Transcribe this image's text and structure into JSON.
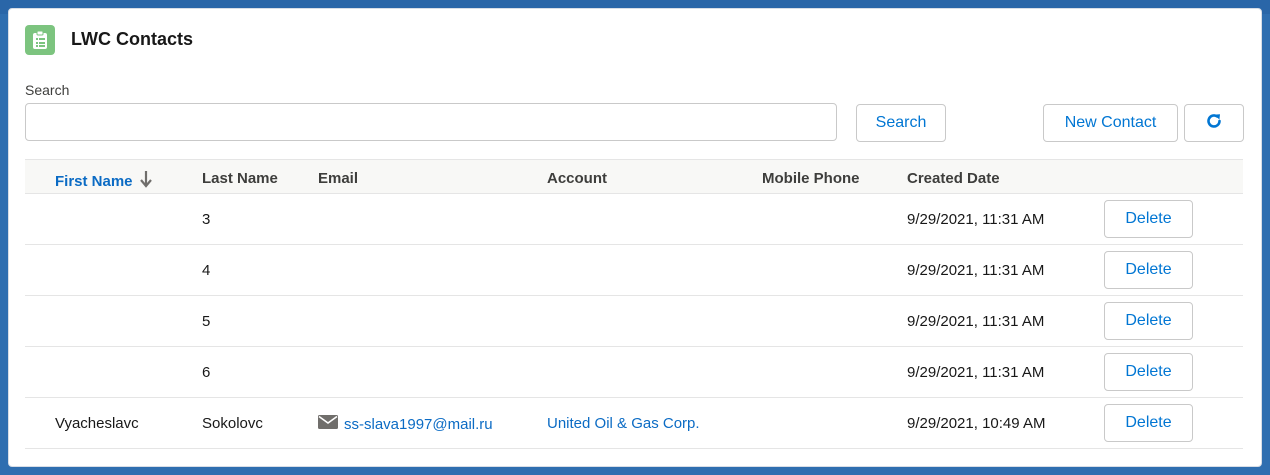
{
  "header": {
    "title": "LWC Contacts",
    "icon": "contact-list-icon"
  },
  "search": {
    "label": "Search",
    "value": "",
    "placeholder": ""
  },
  "buttons": {
    "search": "Search",
    "new_contact": "New Contact",
    "refresh_icon": "refresh-icon"
  },
  "table": {
    "columns": [
      "First Name",
      "Last Name",
      "Email",
      "Account",
      "Mobile Phone",
      "Created Date"
    ],
    "sort": {
      "column": "First Name",
      "direction": "descending"
    },
    "rows": [
      {
        "first_name": "",
        "last_name": "3",
        "email": "",
        "account": "",
        "mobile": "",
        "created": "9/29/2021, 11:31 AM",
        "action": "Delete"
      },
      {
        "first_name": "",
        "last_name": "4",
        "email": "",
        "account": "",
        "mobile": "",
        "created": "9/29/2021, 11:31 AM",
        "action": "Delete"
      },
      {
        "first_name": "",
        "last_name": "5",
        "email": "",
        "account": "",
        "mobile": "",
        "created": "9/29/2021, 11:31 AM",
        "action": "Delete"
      },
      {
        "first_name": "",
        "last_name": "6",
        "email": "",
        "account": "",
        "mobile": "",
        "created": "9/29/2021, 11:31 AM",
        "action": "Delete"
      },
      {
        "first_name": "Vyacheslavc",
        "last_name": "Sokolovc",
        "email": "ss-slava1997@mail.ru",
        "account": "United Oil & Gas Corp.",
        "mobile": "",
        "created": "9/29/2021, 10:49 AM",
        "action": "Delete"
      }
    ]
  },
  "colors": {
    "link": "#0b6bc4",
    "button_text": "#0176d3",
    "header_icon_bg": "#7cc47f",
    "page_bg": "#2f6eb0"
  }
}
